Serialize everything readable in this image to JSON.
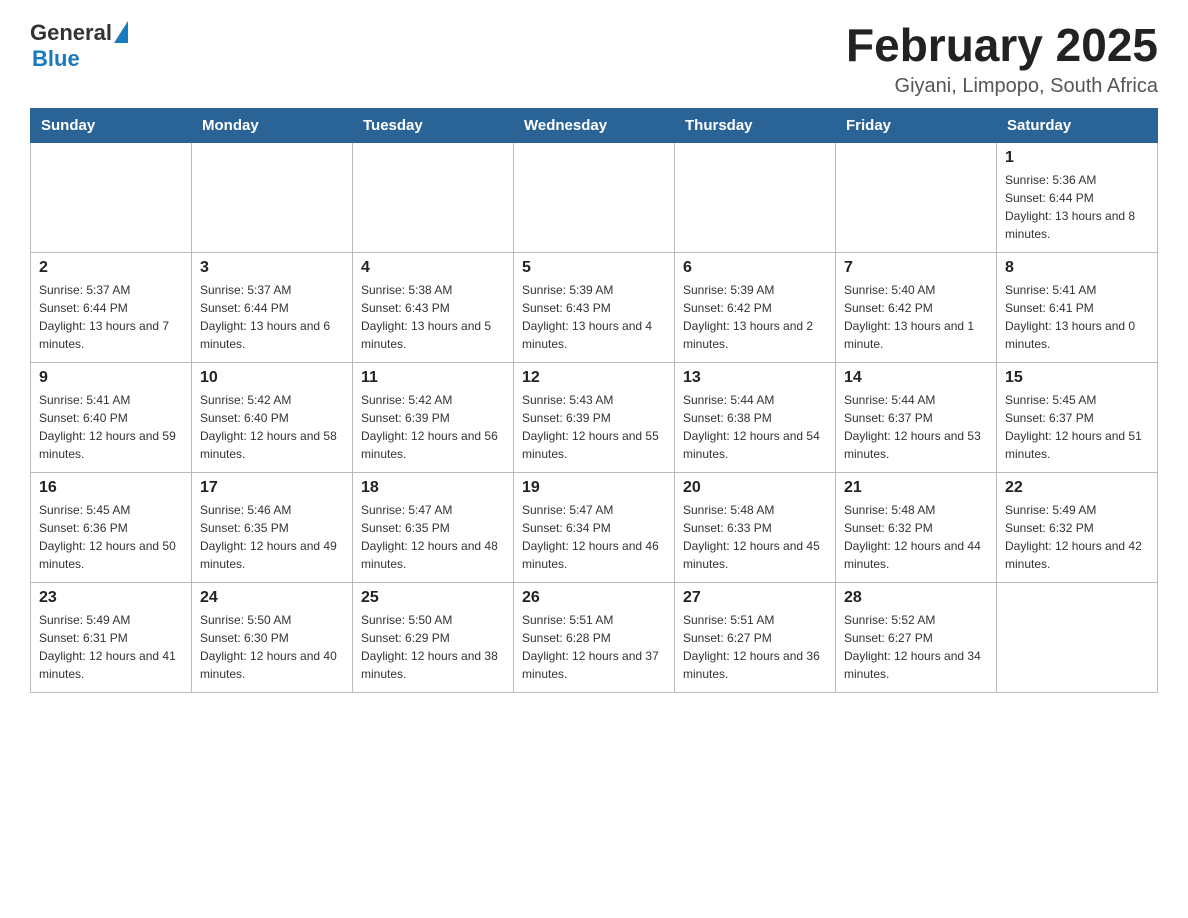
{
  "header": {
    "logo_general": "General",
    "logo_blue": "Blue",
    "month_title": "February 2025",
    "location": "Giyani, Limpopo, South Africa"
  },
  "days_of_week": [
    "Sunday",
    "Monday",
    "Tuesday",
    "Wednesday",
    "Thursday",
    "Friday",
    "Saturday"
  ],
  "weeks": [
    [
      {
        "day": "",
        "info": ""
      },
      {
        "day": "",
        "info": ""
      },
      {
        "day": "",
        "info": ""
      },
      {
        "day": "",
        "info": ""
      },
      {
        "day": "",
        "info": ""
      },
      {
        "day": "",
        "info": ""
      },
      {
        "day": "1",
        "info": "Sunrise: 5:36 AM\nSunset: 6:44 PM\nDaylight: 13 hours and 8 minutes."
      }
    ],
    [
      {
        "day": "2",
        "info": "Sunrise: 5:37 AM\nSunset: 6:44 PM\nDaylight: 13 hours and 7 minutes."
      },
      {
        "day": "3",
        "info": "Sunrise: 5:37 AM\nSunset: 6:44 PM\nDaylight: 13 hours and 6 minutes."
      },
      {
        "day": "4",
        "info": "Sunrise: 5:38 AM\nSunset: 6:43 PM\nDaylight: 13 hours and 5 minutes."
      },
      {
        "day": "5",
        "info": "Sunrise: 5:39 AM\nSunset: 6:43 PM\nDaylight: 13 hours and 4 minutes."
      },
      {
        "day": "6",
        "info": "Sunrise: 5:39 AM\nSunset: 6:42 PM\nDaylight: 13 hours and 2 minutes."
      },
      {
        "day": "7",
        "info": "Sunrise: 5:40 AM\nSunset: 6:42 PM\nDaylight: 13 hours and 1 minute."
      },
      {
        "day": "8",
        "info": "Sunrise: 5:41 AM\nSunset: 6:41 PM\nDaylight: 13 hours and 0 minutes."
      }
    ],
    [
      {
        "day": "9",
        "info": "Sunrise: 5:41 AM\nSunset: 6:40 PM\nDaylight: 12 hours and 59 minutes."
      },
      {
        "day": "10",
        "info": "Sunrise: 5:42 AM\nSunset: 6:40 PM\nDaylight: 12 hours and 58 minutes."
      },
      {
        "day": "11",
        "info": "Sunrise: 5:42 AM\nSunset: 6:39 PM\nDaylight: 12 hours and 56 minutes."
      },
      {
        "day": "12",
        "info": "Sunrise: 5:43 AM\nSunset: 6:39 PM\nDaylight: 12 hours and 55 minutes."
      },
      {
        "day": "13",
        "info": "Sunrise: 5:44 AM\nSunset: 6:38 PM\nDaylight: 12 hours and 54 minutes."
      },
      {
        "day": "14",
        "info": "Sunrise: 5:44 AM\nSunset: 6:37 PM\nDaylight: 12 hours and 53 minutes."
      },
      {
        "day": "15",
        "info": "Sunrise: 5:45 AM\nSunset: 6:37 PM\nDaylight: 12 hours and 51 minutes."
      }
    ],
    [
      {
        "day": "16",
        "info": "Sunrise: 5:45 AM\nSunset: 6:36 PM\nDaylight: 12 hours and 50 minutes."
      },
      {
        "day": "17",
        "info": "Sunrise: 5:46 AM\nSunset: 6:35 PM\nDaylight: 12 hours and 49 minutes."
      },
      {
        "day": "18",
        "info": "Sunrise: 5:47 AM\nSunset: 6:35 PM\nDaylight: 12 hours and 48 minutes."
      },
      {
        "day": "19",
        "info": "Sunrise: 5:47 AM\nSunset: 6:34 PM\nDaylight: 12 hours and 46 minutes."
      },
      {
        "day": "20",
        "info": "Sunrise: 5:48 AM\nSunset: 6:33 PM\nDaylight: 12 hours and 45 minutes."
      },
      {
        "day": "21",
        "info": "Sunrise: 5:48 AM\nSunset: 6:32 PM\nDaylight: 12 hours and 44 minutes."
      },
      {
        "day": "22",
        "info": "Sunrise: 5:49 AM\nSunset: 6:32 PM\nDaylight: 12 hours and 42 minutes."
      }
    ],
    [
      {
        "day": "23",
        "info": "Sunrise: 5:49 AM\nSunset: 6:31 PM\nDaylight: 12 hours and 41 minutes."
      },
      {
        "day": "24",
        "info": "Sunrise: 5:50 AM\nSunset: 6:30 PM\nDaylight: 12 hours and 40 minutes."
      },
      {
        "day": "25",
        "info": "Sunrise: 5:50 AM\nSunset: 6:29 PM\nDaylight: 12 hours and 38 minutes."
      },
      {
        "day": "26",
        "info": "Sunrise: 5:51 AM\nSunset: 6:28 PM\nDaylight: 12 hours and 37 minutes."
      },
      {
        "day": "27",
        "info": "Sunrise: 5:51 AM\nSunset: 6:27 PM\nDaylight: 12 hours and 36 minutes."
      },
      {
        "day": "28",
        "info": "Sunrise: 5:52 AM\nSunset: 6:27 PM\nDaylight: 12 hours and 34 minutes."
      },
      {
        "day": "",
        "info": ""
      }
    ]
  ]
}
